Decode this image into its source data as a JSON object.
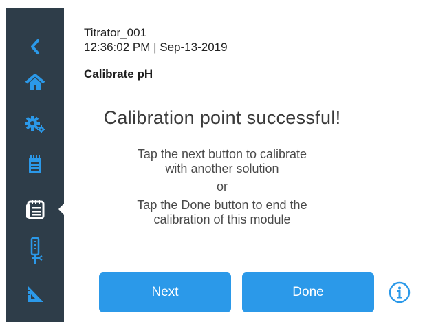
{
  "header": {
    "device_name": "Titrator_001",
    "timestamp": "12:36:02 PM | Sep-13-2019",
    "section_title": "Calibrate pH"
  },
  "main": {
    "headline": "Calibration point successful!",
    "line1": "Tap the next button to calibrate",
    "line2": "with another solution",
    "or": "or",
    "line3": "Tap the Done button to end the",
    "line4": "calibration of this module"
  },
  "buttons": {
    "next_label": "Next",
    "done_label": "Done"
  },
  "sidebar": {
    "items": [
      {
        "icon": "back-arrow-icon"
      },
      {
        "icon": "home-icon"
      },
      {
        "icon": "gears-icon"
      },
      {
        "icon": "notepad-icon"
      },
      {
        "icon": "list-clipboard-icon",
        "active": true
      },
      {
        "icon": "probe-icon"
      },
      {
        "icon": "ruler-triangle-icon"
      }
    ]
  },
  "colors": {
    "sidebar_bg": "#2e3d49",
    "accent": "#2b99e9",
    "button_text": "#ffffff"
  }
}
